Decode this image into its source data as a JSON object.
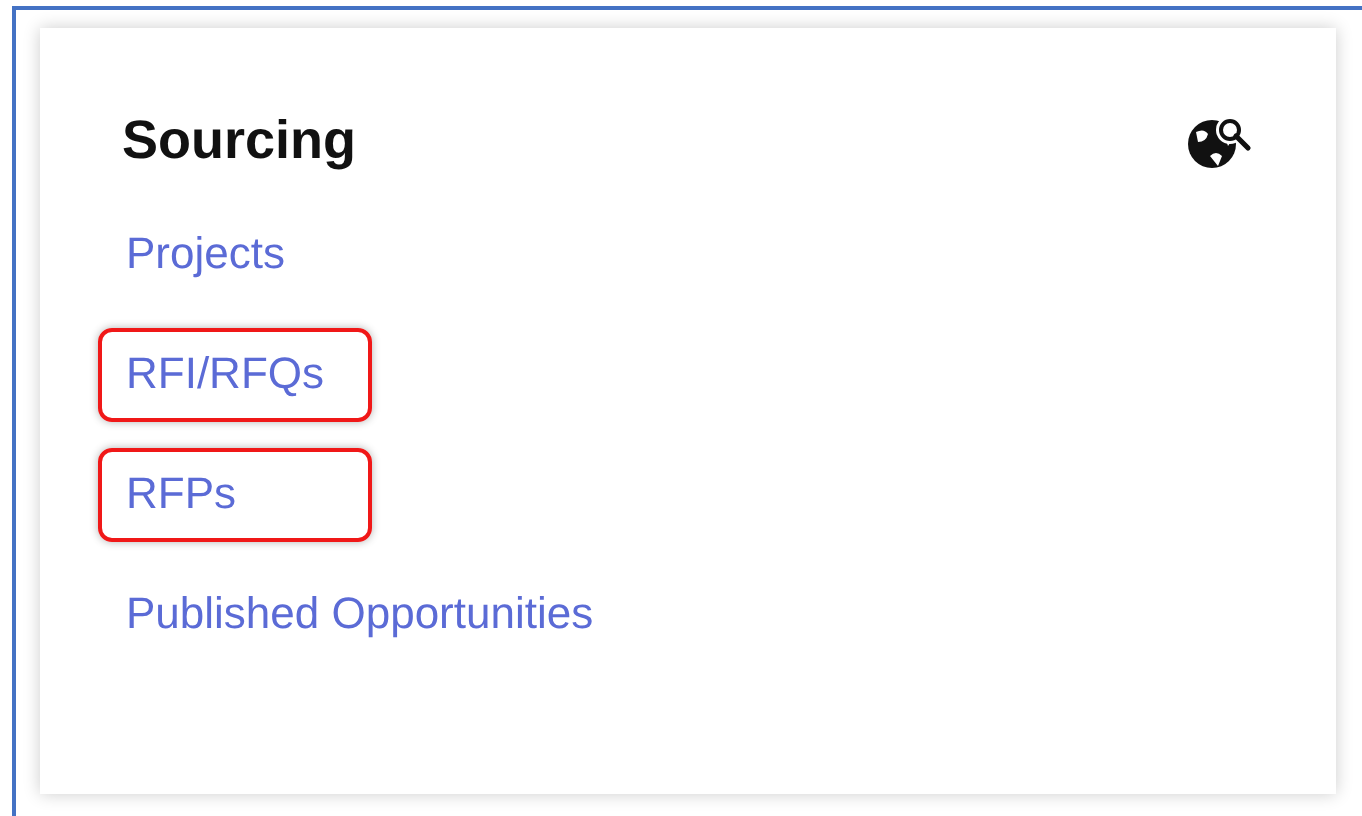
{
  "card": {
    "title": "Sourcing",
    "links": [
      {
        "label": "Projects",
        "highlighted": false
      },
      {
        "label": "RFI/RFQs",
        "highlighted": true
      },
      {
        "label": "RFPs",
        "highlighted": true
      },
      {
        "label": "Published Opportunities",
        "highlighted": false
      }
    ]
  }
}
